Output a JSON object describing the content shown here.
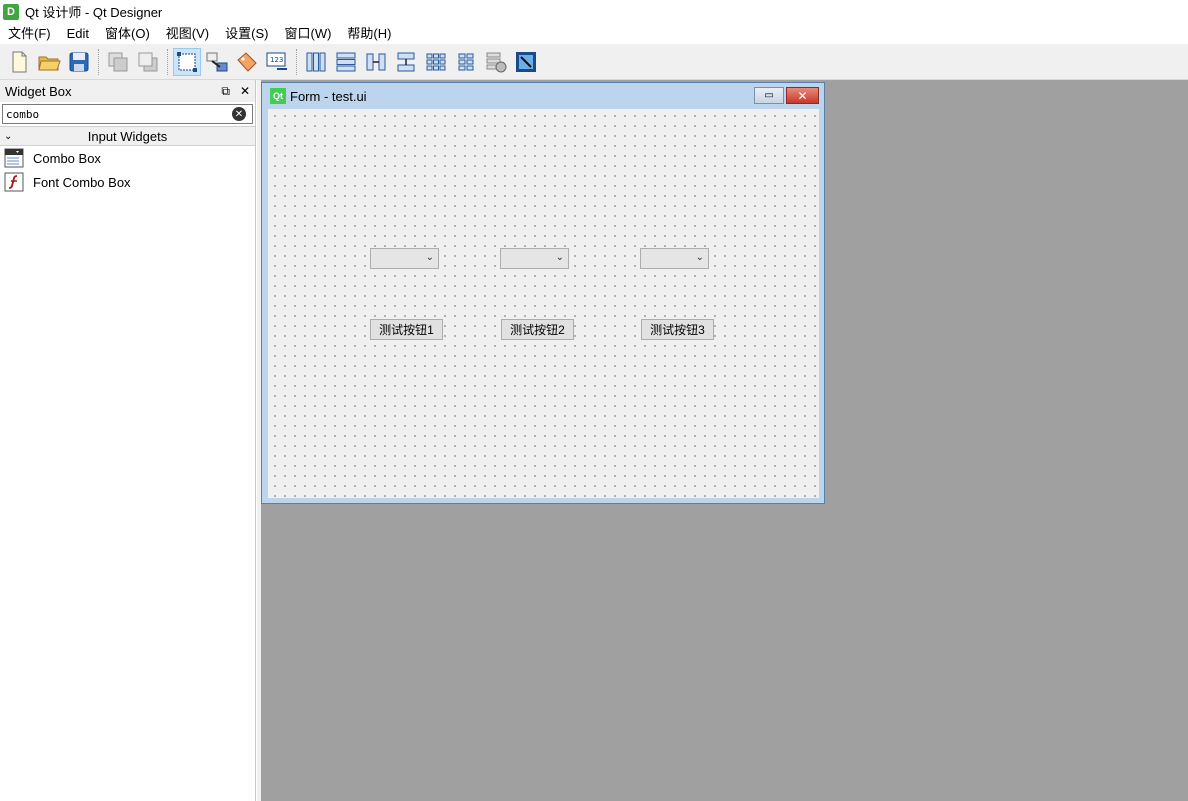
{
  "window": {
    "title": "Qt 设计师 - Qt Designer",
    "icon": "designer-app-icon"
  },
  "menubar": [
    "文件(F)",
    "Edit",
    "窗体(O)",
    "视图(V)",
    "设置(S)",
    "窗口(W)",
    "帮助(H)"
  ],
  "toolbar": {
    "groups": [
      [
        "new-file-icon",
        "open-folder-icon",
        "save-icon"
      ],
      [
        "send-to-back-icon",
        "bring-to-front-icon"
      ],
      [
        "edit-widgets-icon",
        "edit-signals-slots-icon",
        "edit-buddies-icon",
        "edit-tab-order-icon"
      ],
      [
        "layout-horizontal-icon",
        "layout-vertical-icon",
        "layout-horizontal-splitter-icon",
        "layout-vertical-splitter-icon",
        "layout-grid-icon",
        "layout-form-icon",
        "break-layout-icon",
        "adjust-size-icon"
      ]
    ],
    "active": "edit-widgets-icon"
  },
  "widget_box": {
    "title": "Widget Box",
    "search_value": "combo",
    "category": "Input Widgets",
    "items": [
      {
        "label": "Combo Box",
        "icon": "combo-box-icon"
      },
      {
        "label": "Font Combo Box",
        "icon": "font-combo-box-icon"
      }
    ]
  },
  "form": {
    "title": "Form - test.ui",
    "buttons": [
      "测试按钮1",
      "测试按钮2",
      "测试按钮3"
    ]
  }
}
